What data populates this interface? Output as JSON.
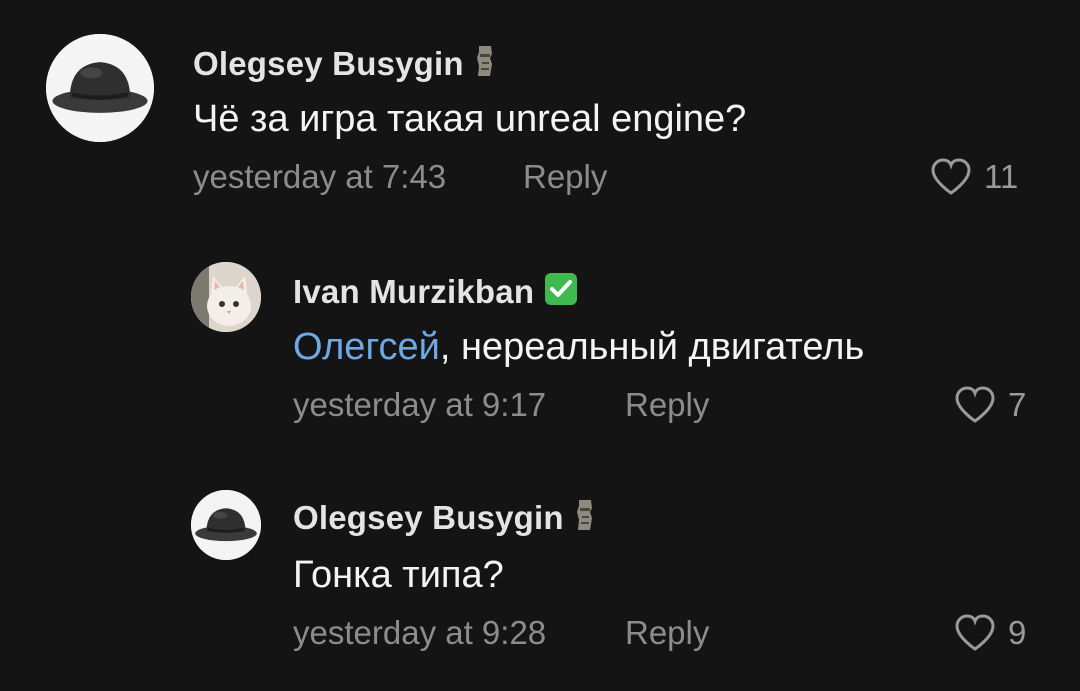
{
  "comments": [
    {
      "author": "Olegsey Busygin",
      "author_badge": "moai-emoji",
      "text": "Чё за игра такая unreal engine?",
      "time": "yesterday at 7:43",
      "reply_label": "Reply",
      "likes": "11",
      "avatar": "bowler-hat"
    },
    {
      "author": "Ivan Murzikban",
      "author_badge": "check-mark-button-emoji",
      "mention": "Олегсей",
      "text": ", нереальный двигатель",
      "time": "yesterday at 9:17",
      "reply_label": "Reply",
      "likes": "7",
      "avatar": "white-cat"
    },
    {
      "author": "Olegsey Busygin",
      "author_badge": "moai-emoji",
      "text": "Гонка типа?",
      "time": "yesterday at 9:28",
      "reply_label": "Reply",
      "likes": "9",
      "avatar": "bowler-hat"
    }
  ],
  "colors": {
    "background": "#141414",
    "mention": "#6fa8e6",
    "meta": "#8c8c8c",
    "verified_green": "#3fb950"
  }
}
